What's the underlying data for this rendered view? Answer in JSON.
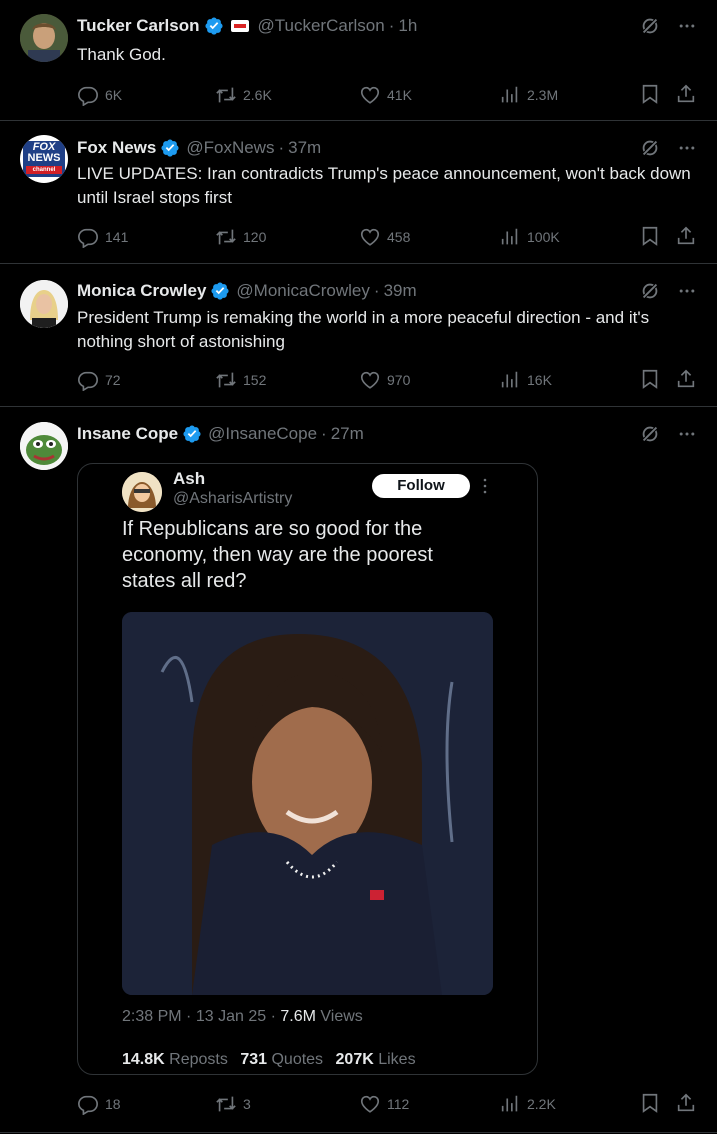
{
  "posts": [
    {
      "name": "Tucker Carlson",
      "handle": "@TuckerCarlson",
      "time": "1h",
      "text": "Thank God.",
      "replies": "6K",
      "reposts": "2.6K",
      "likes": "41K",
      "views": "2.3M"
    },
    {
      "name": "Fox News",
      "handle": "@FoxNews",
      "time": "37m",
      "avatar_text_1": "FOX",
      "avatar_text_2": "NEWS",
      "avatar_text_3": "channel",
      "text": "LIVE UPDATES: Iran contradicts Trump's peace announcement, won't back down until Israel stops first",
      "replies": "141",
      "reposts": "120",
      "likes": "458",
      "views": "100K"
    },
    {
      "name": "Monica Crowley",
      "handle": "@MonicaCrowley",
      "time": "39m",
      "text": "President Trump is remaking the world in a more peaceful direction - and it's nothing short of astonishing",
      "replies": "72",
      "reposts": "152",
      "likes": "970",
      "views": "16K"
    },
    {
      "name": "Insane Cope",
      "handle": "@InsaneCope",
      "time": "27m",
      "replies": "18",
      "reposts": "3",
      "likes": "112",
      "views": "2.2K"
    }
  ],
  "separator": "·",
  "quote": {
    "name": "Ash",
    "handle": "@AsharisArtistry",
    "follow_label": "Follow",
    "text": "If Republicans are so good for the economy, then way are the poorest states all red?",
    "time": "2:38 PM",
    "date": "13 Jan 25",
    "views_count": "7.6M",
    "views_label": "Views",
    "reposts_count": "14.8K",
    "reposts_label": "Reposts",
    "quotes_count": "731",
    "quotes_label": "Quotes",
    "likes_count": "207K",
    "likes_label": "Likes"
  },
  "colors": {
    "background": "#000000",
    "text": "#e7e9ea",
    "muted": "#71767b",
    "verified_blue": "#1d9bf0",
    "border": "#2f3336"
  },
  "icons": [
    "verified-badge-icon",
    "grok-icon",
    "more-icon",
    "reply-icon",
    "repost-icon",
    "like-icon",
    "views-icon",
    "bookmark-icon",
    "share-icon"
  ]
}
